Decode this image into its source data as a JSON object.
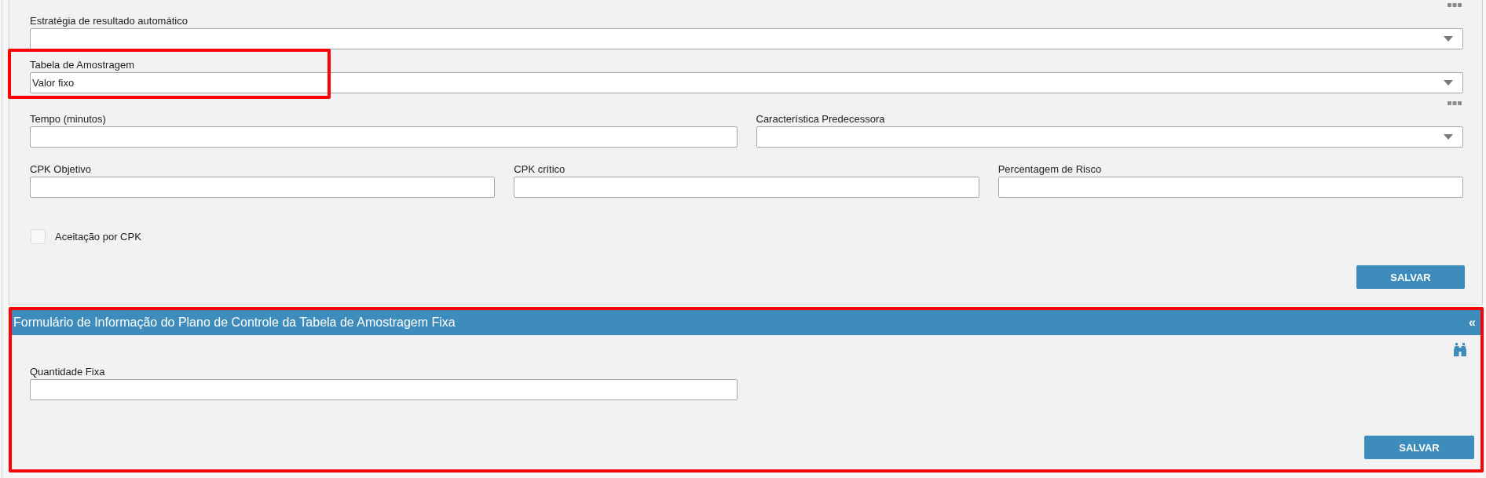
{
  "main_form": {
    "rows": [
      {
        "options_menu": true,
        "fields": [
          {
            "kind": "select",
            "label": "Estratégia de resultado automático",
            "highlighted": false
          }
        ]
      },
      {
        "options_menu": false,
        "fields": [
          {
            "kind": "select",
            "label": "Tabela de Amostragem",
            "value": "Valor fixo",
            "highlighted": true
          }
        ]
      },
      {
        "options_menu": true,
        "fields": [
          {
            "kind": "text",
            "label": "Tempo (minutos)",
            "highlighted": false
          },
          {
            "kind": "select",
            "label": "Característica Predecessora",
            "highlighted": false
          }
        ]
      },
      {
        "options_menu": false,
        "fields": [
          {
            "kind": "text",
            "label": "CPK Objetivo",
            "highlighted": false
          },
          {
            "kind": "text",
            "label": "CPK crítico",
            "highlighted": false
          },
          {
            "kind": "text",
            "label": "Percentagem de Risco",
            "highlighted": false
          }
        ]
      },
      {
        "options_menu": false,
        "fields": [
          {
            "kind": "checkbox",
            "label": "Aceitação por CPK",
            "checked": false,
            "highlighted": false
          }
        ]
      }
    ],
    "save_button": "SALVAR"
  },
  "info_section": {
    "title": "Formulário de Informação do Plano de Controle da Tabela de Amostragem Fixa",
    "collapse_toggle": "«",
    "highlighted": true,
    "fields": [
      {
        "kind": "text",
        "label": "Quantidade Fixa",
        "highlighted": false
      }
    ],
    "save_button": "SALVAR"
  }
}
